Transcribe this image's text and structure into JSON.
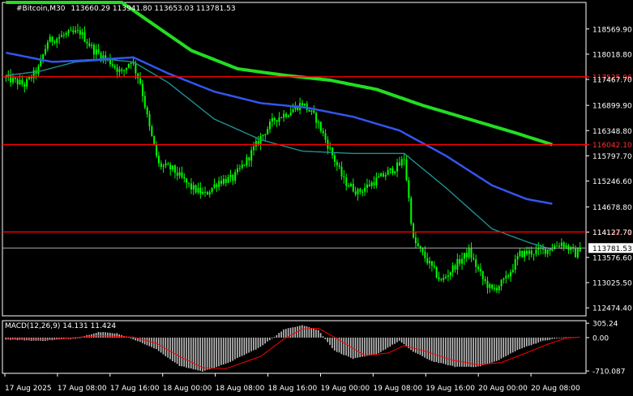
{
  "header": {
    "symbol_label": "#Bitcoin,M30",
    "ohlc": "113660.29 113941.80 113653.03 113781.53"
  },
  "macd_header": {
    "label": "MACD(12,26,9) 14.131 11.424"
  },
  "colors": {
    "background": "#000000",
    "frame": "#ffffff",
    "candle": "#00ff00",
    "ma_fast": "#1e9090",
    "ma_mid": "#3355ee",
    "ma_slow": "#22dd22",
    "level_line": "#ff0000",
    "macd_hist": "#c0c0c0",
    "macd_signal": "#ff0000",
    "tag_text": "#ff3030"
  },
  "chart_data": [
    {
      "type": "candlestick",
      "title": "#Bitcoin,M30",
      "ylim": [
        112300,
        119150
      ],
      "y_ticks": [
        "118569.90",
        "118018.80",
        "117467.70",
        "116899.90",
        "116348.80",
        "115797.70",
        "115246.60",
        "114678.80",
        "114127.70",
        "113576.60",
        "113025.50",
        "112474.40"
      ],
      "x_ticks": [
        "17 Aug 2025",
        "17 Aug 08:00",
        "17 Aug 16:00",
        "18 Aug 00:00",
        "18 Aug 08:00",
        "18 Aug 16:00",
        "19 Aug 00:00",
        "19 Aug 08:00",
        "19 Aug 16:00",
        "20 Aug 00:00",
        "20 Aug 08:00"
      ],
      "price_anchors": [
        [
          0,
          117500
        ],
        [
          8,
          117350
        ],
        [
          14,
          117700
        ],
        [
          18,
          118300
        ],
        [
          26,
          118450
        ],
        [
          32,
          118500
        ],
        [
          38,
          118100
        ],
        [
          44,
          117900
        ],
        [
          50,
          117600
        ],
        [
          54,
          117900
        ],
        [
          58,
          117400
        ],
        [
          62,
          116400
        ],
        [
          66,
          115600
        ],
        [
          72,
          115500
        ],
        [
          80,
          115100
        ],
        [
          86,
          114950
        ],
        [
          92,
          115250
        ],
        [
          98,
          115300
        ],
        [
          104,
          115700
        ],
        [
          110,
          116200
        ],
        [
          116,
          116600
        ],
        [
          122,
          116750
        ],
        [
          128,
          116950
        ],
        [
          134,
          116600
        ],
        [
          138,
          116150
        ],
        [
          142,
          115700
        ],
        [
          146,
          115250
        ],
        [
          152,
          115000
        ],
        [
          158,
          115200
        ],
        [
          164,
          115400
        ],
        [
          170,
          115600
        ],
        [
          172,
          115750
        ],
        [
          176,
          113950
        ],
        [
          182,
          113500
        ],
        [
          188,
          113050
        ],
        [
          194,
          113400
        ],
        [
          200,
          113700
        ],
        [
          206,
          113100
        ],
        [
          210,
          112850
        ],
        [
          216,
          113100
        ],
        [
          222,
          113650
        ],
        [
          228,
          113700
        ],
        [
          234,
          113750
        ],
        [
          240,
          113900
        ],
        [
          246,
          113650
        ],
        [
          248,
          113781.53
        ]
      ],
      "ma_slow": [
        [
          0,
          120900
        ],
        [
          20,
          120100
        ],
        [
          40,
          119500
        ],
        [
          60,
          118800
        ],
        [
          80,
          118100
        ],
        [
          100,
          117700
        ],
        [
          120,
          117560
        ],
        [
          140,
          117450
        ],
        [
          160,
          117250
        ],
        [
          180,
          116900
        ],
        [
          200,
          116600
        ],
        [
          220,
          116300
        ],
        [
          236,
          116042
        ]
      ],
      "ma_mid": [
        [
          0,
          118050
        ],
        [
          20,
          117850
        ],
        [
          40,
          117900
        ],
        [
          55,
          117950
        ],
        [
          70,
          117600
        ],
        [
          90,
          117200
        ],
        [
          110,
          116950
        ],
        [
          130,
          116850
        ],
        [
          150,
          116650
        ],
        [
          170,
          116350
        ],
        [
          190,
          115800
        ],
        [
          210,
          115150
        ],
        [
          225,
          114850
        ],
        [
          236,
          114750
        ]
      ],
      "ma_fast": [
        [
          0,
          117550
        ],
        [
          15,
          117650
        ],
        [
          30,
          117850
        ],
        [
          45,
          117900
        ],
        [
          55,
          117850
        ],
        [
          70,
          117400
        ],
        [
          90,
          116600
        ],
        [
          110,
          116150
        ],
        [
          128,
          115900
        ],
        [
          150,
          115850
        ],
        [
          172,
          115850
        ],
        [
          190,
          115100
        ],
        [
          210,
          114200
        ],
        [
          226,
          113900
        ],
        [
          236,
          113750
        ]
      ],
      "levels": [
        {
          "price": 117525.06,
          "label": "117525.06"
        },
        {
          "price": 116042.1,
          "label": "116042.10"
        },
        {
          "price": 114132.71,
          "label": "114132.71"
        }
      ],
      "current_price": {
        "price": 113781.53,
        "label": "113781.53"
      }
    },
    {
      "type": "macd",
      "title": "MACD(12,26,9) 14.131 11.424",
      "ylim": [
        -760,
        360
      ],
      "y_ticks": [
        "305.24",
        "0.00",
        "-710.087"
      ],
      "hist_anchors": [
        [
          0,
          -40
        ],
        [
          15,
          -70
        ],
        [
          30,
          -20
        ],
        [
          40,
          120
        ],
        [
          48,
          90
        ],
        [
          55,
          -30
        ],
        [
          65,
          -250
        ],
        [
          75,
          -600
        ],
        [
          85,
          -720
        ],
        [
          95,
          -560
        ],
        [
          110,
          -200
        ],
        [
          120,
          170
        ],
        [
          128,
          270
        ],
        [
          135,
          160
        ],
        [
          142,
          -280
        ],
        [
          150,
          -450
        ],
        [
          160,
          -360
        ],
        [
          170,
          -70
        ],
        [
          176,
          -300
        ],
        [
          184,
          -500
        ],
        [
          194,
          -620
        ],
        [
          204,
          -620
        ],
        [
          212,
          -500
        ],
        [
          222,
          -240
        ],
        [
          232,
          -70
        ],
        [
          240,
          0
        ],
        [
          246,
          14
        ]
      ],
      "signal_anchors": [
        [
          0,
          -30
        ],
        [
          20,
          -40
        ],
        [
          40,
          40
        ],
        [
          55,
          10
        ],
        [
          65,
          -120
        ],
        [
          75,
          -400
        ],
        [
          85,
          -640
        ],
        [
          95,
          -660
        ],
        [
          110,
          -400
        ],
        [
          120,
          -30
        ],
        [
          128,
          180
        ],
        [
          135,
          200
        ],
        [
          145,
          -80
        ],
        [
          155,
          -380
        ],
        [
          165,
          -330
        ],
        [
          172,
          -170
        ],
        [
          182,
          -300
        ],
        [
          192,
          -470
        ],
        [
          204,
          -580
        ],
        [
          214,
          -530
        ],
        [
          224,
          -340
        ],
        [
          234,
          -140
        ],
        [
          242,
          -10
        ],
        [
          248,
          11
        ]
      ]
    }
  ]
}
